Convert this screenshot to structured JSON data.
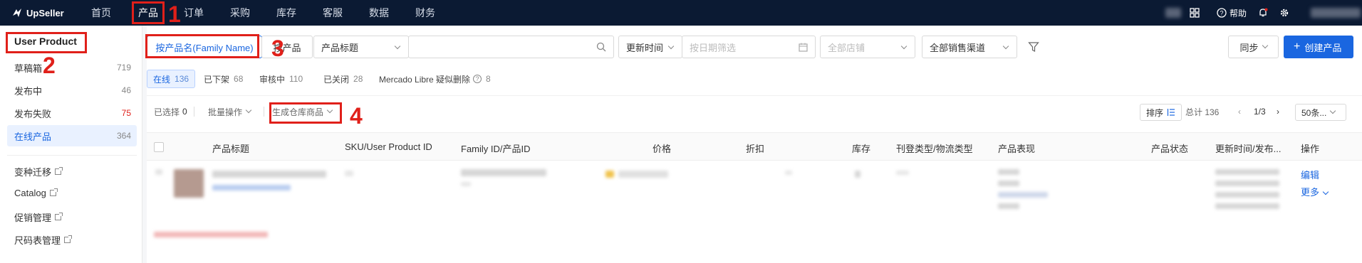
{
  "topbar": {
    "logo": "UpSeller",
    "nav": [
      "首页",
      "产品",
      "订单",
      "采购",
      "库存",
      "客服",
      "数据",
      "财务"
    ],
    "help": "帮助"
  },
  "annotations": [
    "1",
    "2",
    "3",
    "4"
  ],
  "sidebar": {
    "title": "User Product",
    "items": [
      {
        "label": "草稿箱",
        "count": "719"
      },
      {
        "label": "发布中",
        "count": "46"
      },
      {
        "label": "发布失败",
        "count": "75"
      },
      {
        "label": "在线产品",
        "count": "364"
      }
    ],
    "links": [
      "变种迁移",
      "Catalog",
      "促销管理",
      "尺码表管理"
    ]
  },
  "filters": {
    "family_name": "按产品名(Family Name)",
    "by_product": "按产品",
    "title_select": "产品标题",
    "time_select": "更新时间",
    "date_placeholder": "按日期筛选",
    "store_placeholder": "全部店铺",
    "channel_select": "全部销售渠道",
    "sync": "同步",
    "create": "创建产品"
  },
  "tabs": [
    {
      "label": "在线",
      "count": "136"
    },
    {
      "label": "已下架",
      "count": "68"
    },
    {
      "label": "审核中",
      "count": "110"
    },
    {
      "label": "已关闭",
      "count": "28"
    },
    {
      "label": "Mercado Libre 疑似删除",
      "count": "8"
    }
  ],
  "toolbar": {
    "selected": "已选择",
    "selected_count": "0",
    "batch": "批量操作",
    "generate": "生成仓库商品",
    "sort": "排序",
    "total": "总计 136",
    "page": "1/3",
    "page_size": "50条..."
  },
  "table": {
    "headers": [
      "产品标题",
      "SKU/User Product ID",
      "Family ID/产品ID",
      "价格",
      "折扣",
      "库存",
      "刊登类型/物流类型",
      "产品表现",
      "产品状态",
      "更新时间/发布...",
      "操作"
    ],
    "row_actions": {
      "edit": "编辑",
      "more": "更多"
    }
  },
  "colors": {
    "accent": "#1a66e0",
    "topbar": "#0b1a33",
    "annotation": "#e0201a"
  }
}
